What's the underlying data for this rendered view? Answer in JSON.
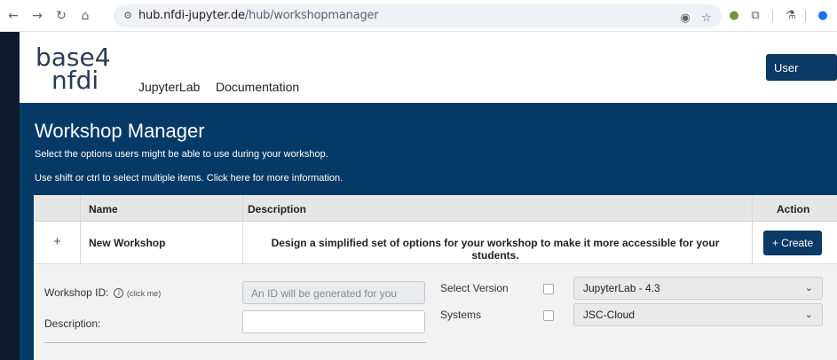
{
  "browser": {
    "url_host": "hub.nfdi-jupyter.de",
    "url_path": "/hub/workshopmanager"
  },
  "header": {
    "logo_line1": "base4",
    "logo_line2": "nfdi",
    "nav": [
      "JupyterLab",
      "Documentation"
    ],
    "user_menu": "User Name ▾"
  },
  "banner": {
    "title": "Workshop Manager",
    "subtitle1": "Select the options users might be able to use during your workshop.",
    "subtitle2": "Use shift or ctrl to select multiple items. Click here for more information."
  },
  "table": {
    "headers": {
      "name": "Name",
      "description": "Description",
      "action": "Action"
    },
    "row": {
      "expand": "+",
      "name": "New Workshop",
      "description": "Design a simplified set of options for your workshop to make it more accessible for your students.",
      "action": "+ Create"
    }
  },
  "form": {
    "workshop_id_label": "Workshop ID:",
    "workshop_id_hint": "(click me)",
    "workshop_id_placeholder": "An ID will be generated for you",
    "description_label": "Description:",
    "select_version_label": "Select Version",
    "select_version_value": "JupyterLab - 4.3",
    "systems_label": "Systems",
    "systems_value": "JSC-Cloud"
  }
}
